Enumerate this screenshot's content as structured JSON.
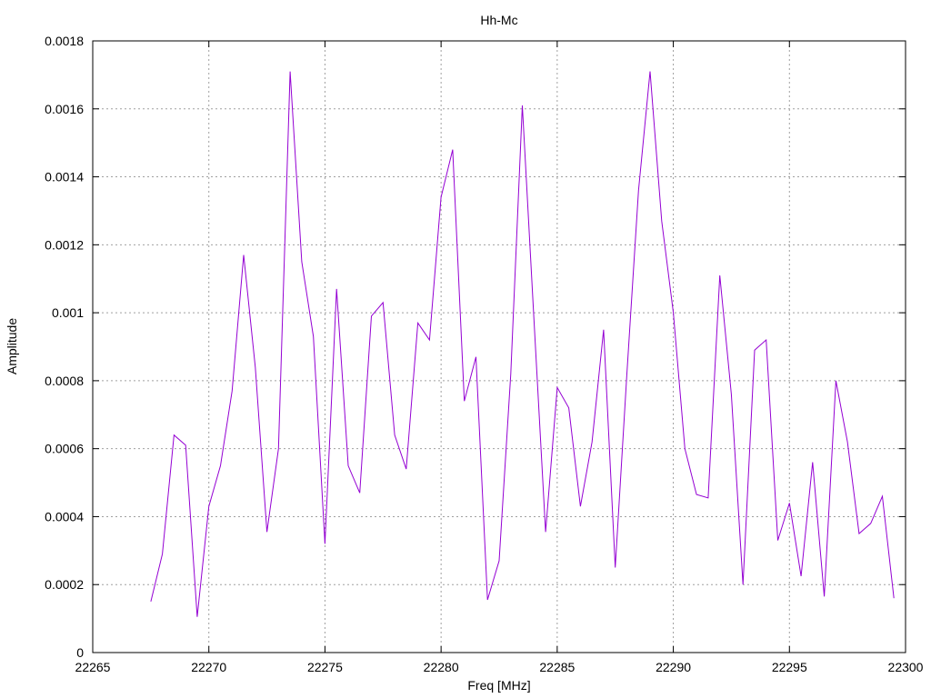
{
  "chart_data": {
    "type": "line",
    "title": "Hh-Mc",
    "xlabel": "Freq [MHz]",
    "ylabel": "Amplitude",
    "xlim": [
      22265,
      22300
    ],
    "ylim": [
      0,
      0.0018
    ],
    "xticks": [
      22265,
      22270,
      22275,
      22280,
      22285,
      22290,
      22295,
      22300
    ],
    "xtick_labels": [
      "22265",
      "22270",
      "22275",
      "22280",
      "22285",
      "22290",
      "22295",
      "22300"
    ],
    "yticks": [
      0,
      0.0002,
      0.0004,
      0.0006,
      0.0008,
      0.001,
      0.0012,
      0.0014,
      0.0016,
      0.0018
    ],
    "ytick_labels": [
      "0",
      "0.0002",
      "0.0004",
      "0.0006",
      "0.0008",
      "0.001",
      "0.0012",
      "0.0014",
      "0.0016",
      "0.0018"
    ],
    "grid": true,
    "series": [
      {
        "color": "#9400d3",
        "x": [
          22267.5,
          22268,
          22268.5,
          22269,
          22269.5,
          22270,
          22270.5,
          22271,
          22271.5,
          22272,
          22272.5,
          22273,
          22273.5,
          22274,
          22274.5,
          22275,
          22275.5,
          22276,
          22276.5,
          22277,
          22277.5,
          22278,
          22278.5,
          22279,
          22279.5,
          22280,
          22280.5,
          22281,
          22281.5,
          22282,
          22282.5,
          22283,
          22283.5,
          22284,
          22284.5,
          22285,
          22285.5,
          22286,
          22286.5,
          22287,
          22287.5,
          22288,
          22288.5,
          22289,
          22289.5,
          22290,
          22290.5,
          22291,
          22291.5,
          22292,
          22292.5,
          22293,
          22293.5,
          22294,
          22294.5,
          22295,
          22295.5,
          22296,
          22296.5,
          22297,
          22297.5,
          22298,
          22298.5,
          22299,
          22299.5
        ],
        "y": [
          0.00015,
          0.00029,
          0.00064,
          0.00061,
          0.000105,
          0.00043,
          0.00055,
          0.00077,
          0.00117,
          0.00084,
          0.000355,
          0.0006,
          0.00171,
          0.00115,
          0.00093,
          0.00032,
          0.00107,
          0.00055,
          0.00047,
          0.00099,
          0.00103,
          0.00064,
          0.00054,
          0.00097,
          0.00092,
          0.00134,
          0.00148,
          0.00074,
          0.00087,
          0.000155,
          0.00027,
          0.00082,
          0.00161,
          0.00098,
          0.000355,
          0.00078,
          0.00072,
          0.00043,
          0.00062,
          0.00095,
          0.00025,
          0.00082,
          0.00136,
          0.00171,
          0.00127,
          0.001,
          0.0006,
          0.000465,
          0.000455,
          0.00111,
          0.00076,
          0.0002,
          0.00089,
          0.00092,
          0.00033,
          0.00044,
          0.000225,
          0.00056,
          0.000165,
          0.0008,
          0.00062,
          0.00035,
          0.00038,
          0.00046,
          0.00016
        ]
      }
    ]
  }
}
